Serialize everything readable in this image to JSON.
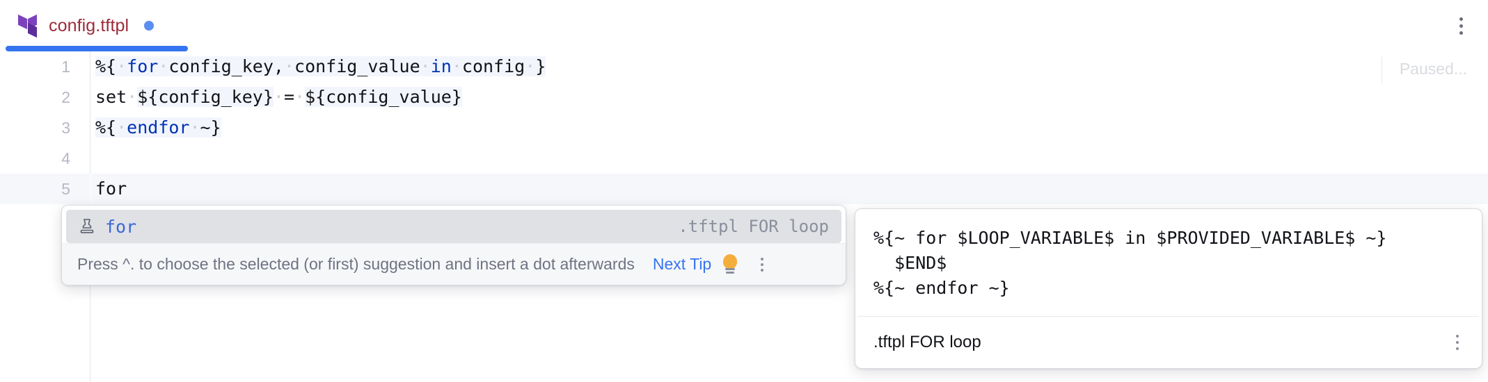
{
  "window": {
    "tab": {
      "icon": "terraform-logo-icon",
      "filename": "config.tftpl",
      "modified_indicator": "●"
    },
    "more_menu_icon": "vertical-dots-icon"
  },
  "editor": {
    "status_right": "Paused...",
    "current_line": 5,
    "lines": [
      {
        "number": "1",
        "text": "%{ for config_key, config_value in config }"
      },
      {
        "number": "2",
        "text": "set ${config_key} = ${config_value}"
      },
      {
        "number": "3",
        "text": "%{ endfor ~}"
      },
      {
        "number": "4",
        "text": ""
      },
      {
        "number": "5",
        "text": "for"
      }
    ]
  },
  "completion_popup": {
    "suggestions": [
      {
        "icon": "live-template-stamp-icon",
        "label": "for",
        "type_text": ".tftpl FOR loop",
        "selected": true
      }
    ],
    "tip": {
      "text": "Press ^. to choose the selected (or first) suggestion and insert a dot afterwards",
      "link_label": "Next Tip",
      "bulb_icon": "lightbulb-icon",
      "more_icon": "vertical-dots-icon"
    }
  },
  "documentation_panel": {
    "code": "%{~ for $LOOP_VARIABLE$ in $PROVIDED_VARIABLE$ ~}\n  $END$\n%{~ endfor ~}",
    "footer_label": ".tftpl FOR loop",
    "more_icon": "vertical-dots-icon"
  },
  "colors": {
    "keyword": "#0033b3",
    "tab_title": "#9e2b39",
    "accent_blue": "#3574f0",
    "terraform_purple": "#7B42BC",
    "modified_dot": "#5b8ef0",
    "bulb_orange": "#f5ad3c"
  }
}
